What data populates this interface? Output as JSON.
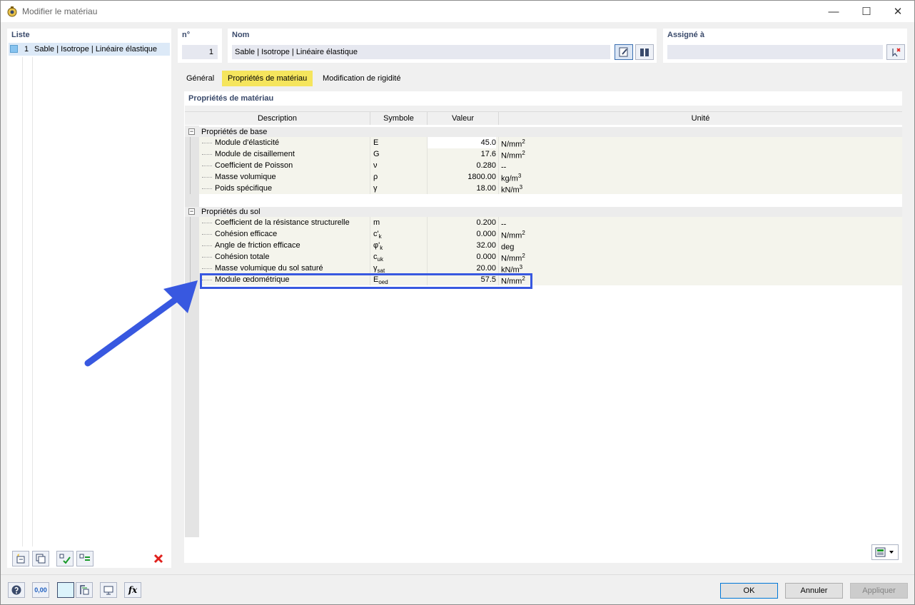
{
  "window": {
    "title": "Modifier le matériau",
    "controls": {
      "minimize": "—",
      "maximize": "☐",
      "close": "✕"
    }
  },
  "list_panel": {
    "header": "Liste",
    "items": [
      {
        "number": "1",
        "label": "Sable | Isotrope | Linéaire élastique",
        "color": "#87c3ef"
      }
    ]
  },
  "number_panel": {
    "header": "n°",
    "value": "1"
  },
  "name_panel": {
    "header": "Nom",
    "value": "Sable | Isotrope | Linéaire élastique"
  },
  "assigned_panel": {
    "header": "Assigné à",
    "value": ""
  },
  "tabs": [
    {
      "label": "Général",
      "active": false
    },
    {
      "label": "Propriétés de matériau",
      "active": true
    },
    {
      "label": "Modification de rigidité",
      "active": false
    }
  ],
  "properties": {
    "section_title": "Propriétés de matériau",
    "columns": {
      "description": "Description",
      "symbol": "Symbole",
      "value": "Valeur",
      "unit": "Unité"
    },
    "groups": [
      {
        "label": "Propriétés de base",
        "toggle": "−",
        "rows": [
          {
            "description": "Module d'élasticité",
            "symbol": "E",
            "symbol_sub": "",
            "value": "45.0",
            "unit": "N/mm",
            "unit_sup": "2"
          },
          {
            "description": "Module de cisaillement",
            "symbol": "G",
            "symbol_sub": "",
            "value": "17.6",
            "unit": "N/mm",
            "unit_sup": "2"
          },
          {
            "description": "Coefficient de Poisson",
            "symbol": "ν",
            "symbol_sub": "",
            "value": "0.280",
            "unit": "--",
            "unit_sup": ""
          },
          {
            "description": "Masse volumique",
            "symbol": "ρ",
            "symbol_sub": "",
            "value": "1800.00",
            "unit": "kg/m",
            "unit_sup": "3"
          },
          {
            "description": "Poids spécifique",
            "symbol": "γ",
            "symbol_sub": "",
            "value": "18.00",
            "unit": "kN/m",
            "unit_sup": "3"
          }
        ]
      },
      {
        "label": "Propriétés du sol",
        "toggle": "−",
        "rows": [
          {
            "description": "Coefficient de la résistance structurelle",
            "symbol": "m",
            "symbol_sub": "",
            "value": "0.200",
            "unit": "--",
            "unit_sup": ""
          },
          {
            "description": "Cohésion efficace",
            "symbol": "c'",
            "symbol_sub": "k",
            "value": "0.000",
            "unit": "N/mm",
            "unit_sup": "2"
          },
          {
            "description": "Angle de friction efficace",
            "symbol": "φ'",
            "symbol_sub": "k",
            "value": "32.00",
            "unit": "deg",
            "unit_sup": ""
          },
          {
            "description": "Cohésion totale",
            "symbol": "c",
            "symbol_sub": "uk",
            "value": "0.000",
            "unit": "N/mm",
            "unit_sup": "2"
          },
          {
            "description": "Masse volumique du sol saturé",
            "symbol": "γ",
            "symbol_sub": "sat",
            "value": "20.00",
            "unit": "kN/m",
            "unit_sup": "3"
          },
          {
            "description": "Module œdométrique",
            "symbol": "E",
            "symbol_sub": "oed",
            "value": "57.5",
            "unit": "N/mm",
            "unit_sup": "2"
          }
        ]
      }
    ]
  },
  "icons": {
    "edit_name": "edit-pencil-icon",
    "library": "book-library-icon",
    "clear_assignment": "clear-selection-icon",
    "table_export": "table-export-icon",
    "new_material": "new-item-icon",
    "copy_material": "copy-item-icon",
    "check_all": "check-icon",
    "check_used": "check-filter-icon",
    "delete": "delete-icon",
    "help": "help-icon",
    "decimal_places": "decimal-places-icon",
    "color_swatch": "color-swatch-icon",
    "units": "units-icon",
    "view": "view-icon",
    "formula": "formula-icon"
  },
  "bottom_labels": {
    "decimals": "0,00",
    "formula": "fx"
  },
  "buttons": {
    "ok": "OK",
    "cancel": "Annuler",
    "apply": "Appliquer"
  },
  "colors": {
    "active_tab": "#f5e55d",
    "highlight_box": "#3858e0",
    "arrow": "#3858e0",
    "delete_x": "#e0201c"
  }
}
